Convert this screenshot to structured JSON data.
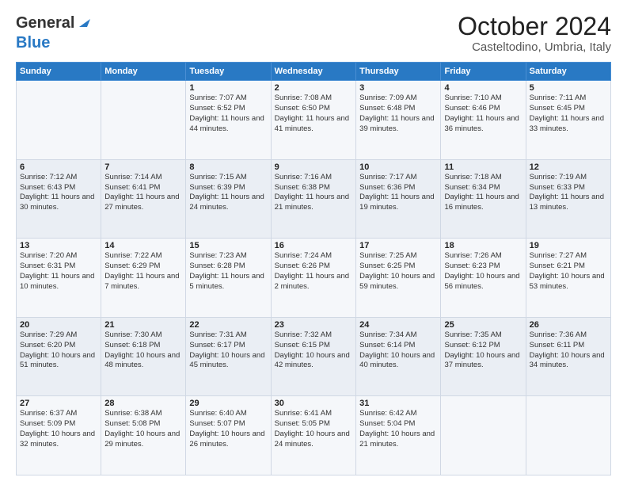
{
  "header": {
    "logo_line1": "General",
    "logo_line2": "Blue",
    "title": "October 2024",
    "subtitle": "Casteltodino, Umbria, Italy"
  },
  "days_of_week": [
    "Sunday",
    "Monday",
    "Tuesday",
    "Wednesday",
    "Thursday",
    "Friday",
    "Saturday"
  ],
  "weeks": [
    [
      {
        "day": "",
        "info": ""
      },
      {
        "day": "",
        "info": ""
      },
      {
        "day": "1",
        "info": "Sunrise: 7:07 AM\nSunset: 6:52 PM\nDaylight: 11 hours and 44 minutes."
      },
      {
        "day": "2",
        "info": "Sunrise: 7:08 AM\nSunset: 6:50 PM\nDaylight: 11 hours and 41 minutes."
      },
      {
        "day": "3",
        "info": "Sunrise: 7:09 AM\nSunset: 6:48 PM\nDaylight: 11 hours and 39 minutes."
      },
      {
        "day": "4",
        "info": "Sunrise: 7:10 AM\nSunset: 6:46 PM\nDaylight: 11 hours and 36 minutes."
      },
      {
        "day": "5",
        "info": "Sunrise: 7:11 AM\nSunset: 6:45 PM\nDaylight: 11 hours and 33 minutes."
      }
    ],
    [
      {
        "day": "6",
        "info": "Sunrise: 7:12 AM\nSunset: 6:43 PM\nDaylight: 11 hours and 30 minutes."
      },
      {
        "day": "7",
        "info": "Sunrise: 7:14 AM\nSunset: 6:41 PM\nDaylight: 11 hours and 27 minutes."
      },
      {
        "day": "8",
        "info": "Sunrise: 7:15 AM\nSunset: 6:39 PM\nDaylight: 11 hours and 24 minutes."
      },
      {
        "day": "9",
        "info": "Sunrise: 7:16 AM\nSunset: 6:38 PM\nDaylight: 11 hours and 21 minutes."
      },
      {
        "day": "10",
        "info": "Sunrise: 7:17 AM\nSunset: 6:36 PM\nDaylight: 11 hours and 19 minutes."
      },
      {
        "day": "11",
        "info": "Sunrise: 7:18 AM\nSunset: 6:34 PM\nDaylight: 11 hours and 16 minutes."
      },
      {
        "day": "12",
        "info": "Sunrise: 7:19 AM\nSunset: 6:33 PM\nDaylight: 11 hours and 13 minutes."
      }
    ],
    [
      {
        "day": "13",
        "info": "Sunrise: 7:20 AM\nSunset: 6:31 PM\nDaylight: 11 hours and 10 minutes."
      },
      {
        "day": "14",
        "info": "Sunrise: 7:22 AM\nSunset: 6:29 PM\nDaylight: 11 hours and 7 minutes."
      },
      {
        "day": "15",
        "info": "Sunrise: 7:23 AM\nSunset: 6:28 PM\nDaylight: 11 hours and 5 minutes."
      },
      {
        "day": "16",
        "info": "Sunrise: 7:24 AM\nSunset: 6:26 PM\nDaylight: 11 hours and 2 minutes."
      },
      {
        "day": "17",
        "info": "Sunrise: 7:25 AM\nSunset: 6:25 PM\nDaylight: 10 hours and 59 minutes."
      },
      {
        "day": "18",
        "info": "Sunrise: 7:26 AM\nSunset: 6:23 PM\nDaylight: 10 hours and 56 minutes."
      },
      {
        "day": "19",
        "info": "Sunrise: 7:27 AM\nSunset: 6:21 PM\nDaylight: 10 hours and 53 minutes."
      }
    ],
    [
      {
        "day": "20",
        "info": "Sunrise: 7:29 AM\nSunset: 6:20 PM\nDaylight: 10 hours and 51 minutes."
      },
      {
        "day": "21",
        "info": "Sunrise: 7:30 AM\nSunset: 6:18 PM\nDaylight: 10 hours and 48 minutes."
      },
      {
        "day": "22",
        "info": "Sunrise: 7:31 AM\nSunset: 6:17 PM\nDaylight: 10 hours and 45 minutes."
      },
      {
        "day": "23",
        "info": "Sunrise: 7:32 AM\nSunset: 6:15 PM\nDaylight: 10 hours and 42 minutes."
      },
      {
        "day": "24",
        "info": "Sunrise: 7:34 AM\nSunset: 6:14 PM\nDaylight: 10 hours and 40 minutes."
      },
      {
        "day": "25",
        "info": "Sunrise: 7:35 AM\nSunset: 6:12 PM\nDaylight: 10 hours and 37 minutes."
      },
      {
        "day": "26",
        "info": "Sunrise: 7:36 AM\nSunset: 6:11 PM\nDaylight: 10 hours and 34 minutes."
      }
    ],
    [
      {
        "day": "27",
        "info": "Sunrise: 6:37 AM\nSunset: 5:09 PM\nDaylight: 10 hours and 32 minutes."
      },
      {
        "day": "28",
        "info": "Sunrise: 6:38 AM\nSunset: 5:08 PM\nDaylight: 10 hours and 29 minutes."
      },
      {
        "day": "29",
        "info": "Sunrise: 6:40 AM\nSunset: 5:07 PM\nDaylight: 10 hours and 26 minutes."
      },
      {
        "day": "30",
        "info": "Sunrise: 6:41 AM\nSunset: 5:05 PM\nDaylight: 10 hours and 24 minutes."
      },
      {
        "day": "31",
        "info": "Sunrise: 6:42 AM\nSunset: 5:04 PM\nDaylight: 10 hours and 21 minutes."
      },
      {
        "day": "",
        "info": ""
      },
      {
        "day": "",
        "info": ""
      }
    ]
  ]
}
